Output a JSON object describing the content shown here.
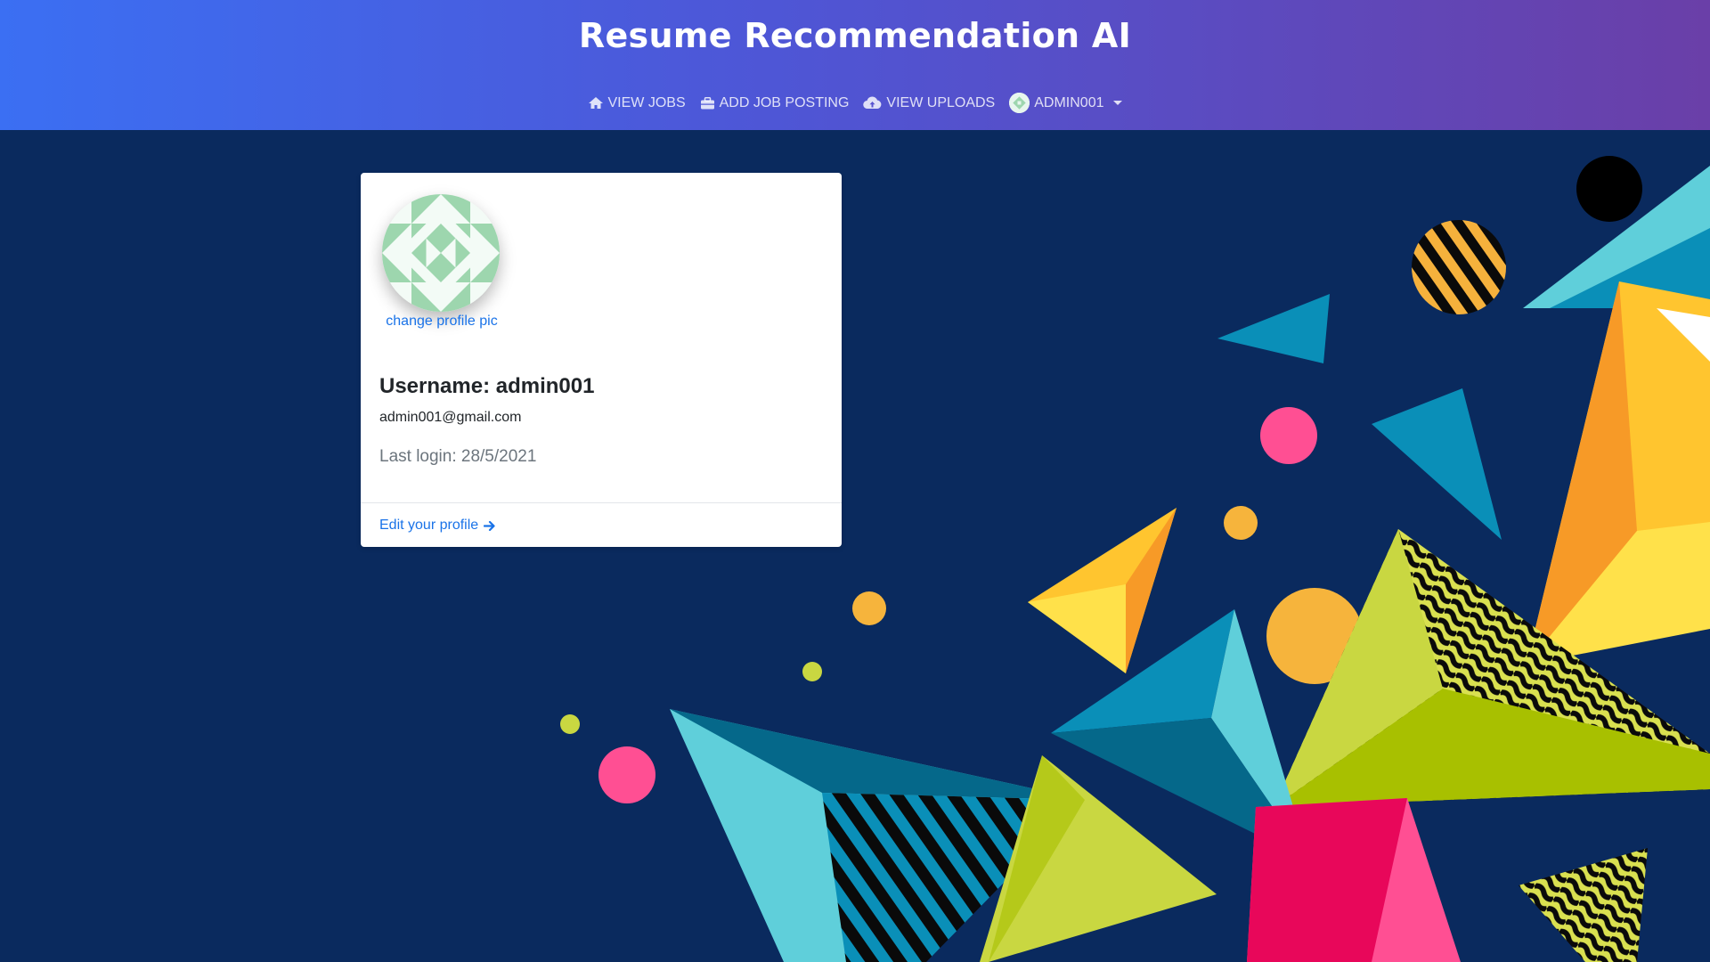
{
  "header": {
    "title": "Resume Recommendation AI"
  },
  "nav": {
    "items": [
      {
        "label": "VIEW JOBS",
        "icon": "home-icon"
      },
      {
        "label": "ADD JOB POSTING",
        "icon": "briefcase-icon"
      },
      {
        "label": "VIEW UPLOADS",
        "icon": "cloud-upload-icon"
      }
    ],
    "user_menu": {
      "label": "ADMIN001",
      "icon": "avatar"
    }
  },
  "profile": {
    "change_pic_label": "change profile pic",
    "username_label": "Username: admin001",
    "email": "admin001@gmail.com",
    "last_login": "Last login: 28/5/2021",
    "edit_link_label": "Edit your profile"
  },
  "colors": {
    "header_gradient_start": "#3b6ff3",
    "header_gradient_end": "#6a3fa8",
    "background": "#0a2a5e",
    "link": "#1a73e8",
    "avatar_pattern": "#9dd6ae"
  }
}
